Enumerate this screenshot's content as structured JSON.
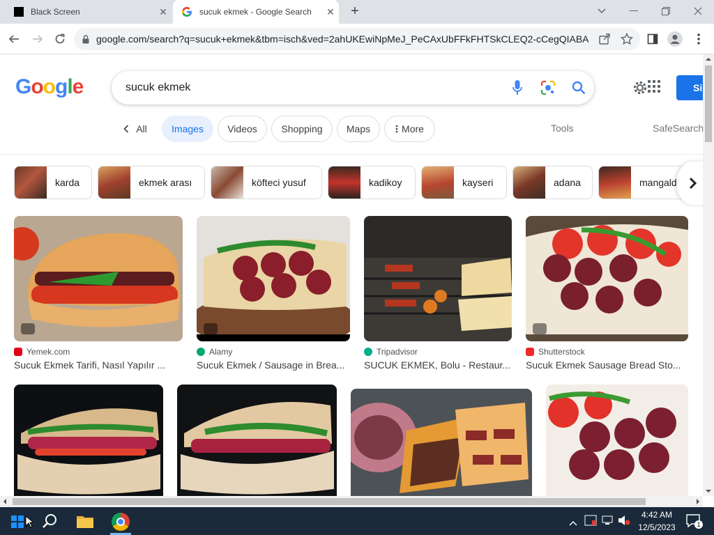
{
  "browser": {
    "tabs": [
      {
        "title": "Black Screen",
        "active": false
      },
      {
        "title": "sucuk ekmek - Google Search",
        "active": true
      }
    ],
    "url": "google.com/search?q=sucuk+ekmek&tbm=isch&ved=2ahUKEwiNpMeJ_PeCAxUbFFkFHTSkCLEQ2-cCegQIABAA..."
  },
  "google": {
    "query": "sucuk ekmek",
    "signin_label": "Si",
    "nav": {
      "all": "All",
      "images": "Images",
      "videos": "Videos",
      "shopping": "Shopping",
      "maps": "Maps",
      "more": "More",
      "tools": "Tools",
      "safesearch": "SafeSearch"
    },
    "related": [
      "karda",
      "ekmek arası",
      "köfteci yusuf",
      "kadikoy",
      "kayseri",
      "adana",
      "mangald"
    ],
    "results": [
      {
        "source": "Yemek.com",
        "caption": "Sucuk Ekmek Tarifi, Nasıl Yapılır ...",
        "color": "#e2001a"
      },
      {
        "source": "Alamy",
        "caption": "Sucuk Ekmek / Sausage in Brea...",
        "color": "#00a86b"
      },
      {
        "source": "Tripadvisor",
        "caption": "SUCUK EKMEK, Bolu - Restaur...",
        "color": "#00af87"
      },
      {
        "source": "Shutterstock",
        "caption": "Sucuk Ekmek Sausage Bread Sto...",
        "color": "#ee2b24"
      }
    ]
  },
  "taskbar": {
    "time": "4:42 AM",
    "date": "12/5/2023",
    "notification_count": "1"
  }
}
